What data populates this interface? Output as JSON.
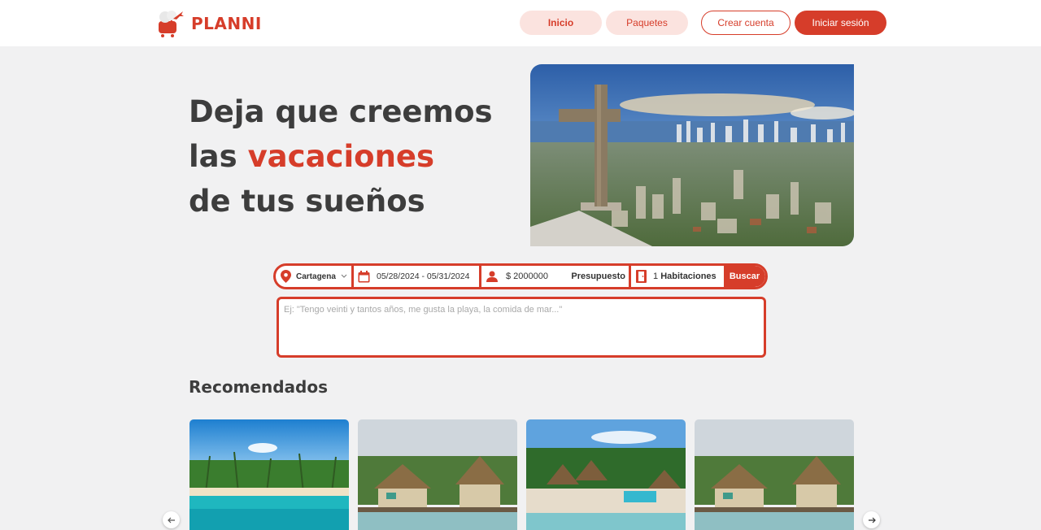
{
  "brand": {
    "name": "PLANNI",
    "color": "#d63d2a"
  },
  "nav": {
    "inicio": "Inicio",
    "paquetes": "Paquetes",
    "crear_cuenta": "Crear cuenta",
    "iniciar_sesion": "Iniciar sesión"
  },
  "hero": {
    "line1": "Deja que creemos",
    "line2_pre": "las ",
    "line2_accent": "vacaciones",
    "line3": "de tus sueños"
  },
  "search": {
    "destination": "Cartagena",
    "dates": "05/28/2024 - 05/31/2024",
    "budget_value": "$ 2000000",
    "budget_label": "Presupuesto",
    "rooms_count": "1",
    "rooms_label": "Habitaciones",
    "button": "Buscar",
    "prompt_placeholder": "Ej: \"Tengo veinti y tantos años, me gusta la playa, la comida de mar...\""
  },
  "recommended": {
    "title": "Recomendados",
    "cards": [
      {
        "scene": "beach-palms-icon"
      },
      {
        "scene": "thatched-hotel-icon"
      },
      {
        "scene": "resort-pool-icon"
      },
      {
        "scene": "thatched-hotel-icon"
      }
    ]
  },
  "icons": [
    "plane-suitcase-logo-icon",
    "location-pin-icon",
    "chevron-down-icon",
    "calendar-icon",
    "user-icon",
    "door-icon",
    "arrow-left-icon",
    "arrow-right-icon"
  ]
}
